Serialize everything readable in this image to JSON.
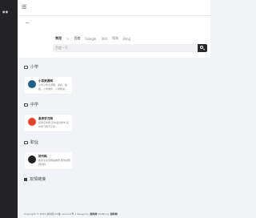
{
  "topbar": {
    "menu_icon": "menu-icon"
  },
  "search": {
    "category": "常用",
    "separator": ">",
    "engines": [
      "百度",
      "Google",
      "360",
      "搜狗",
      "Bing"
    ],
    "active_engine": "百度",
    "placeholder": "百度一下"
  },
  "sections": [
    {
      "title": "小学",
      "cards": [
        {
          "title": "小学资源网",
          "desc": "小学小学资源网，资料，数据，小学课件，小学教案，小..."
        }
      ]
    },
    {
      "title": "中学",
      "cards": [
        {
          "title": "高考学习网",
          "desc": "初中高考网,高中语文数学,初中学习教育高考..."
        }
      ]
    },
    {
      "title": "职业",
      "cards": [
        {
          "title": "好代码",
          "desc": "各专业资源网站推送,帮你发帮网资料..."
        }
      ]
    }
  ],
  "friend_links": {
    "title": "友情链接"
  },
  "footer": {
    "copyright": "Copyright © 2023 资料网 ICP备 xxxxxxx号-1",
    "design_by_label": "Design by",
    "design_by": "资料网",
    "modify_by_label": "Modify by",
    "modify_by": "资料网"
  },
  "colors": {
    "sidebar": "#232326",
    "accent_link": "#3b82f6",
    "active_engine": "#333333"
  }
}
